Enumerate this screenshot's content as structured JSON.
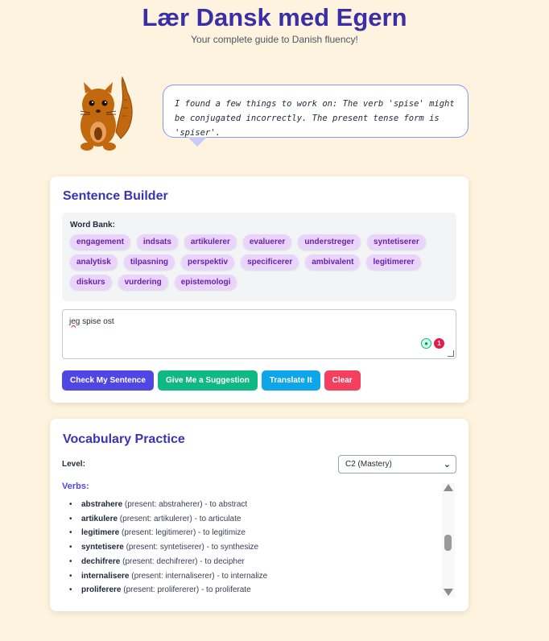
{
  "header": {
    "title": "Lær Dansk med Egern",
    "subtitle": "Your complete guide to Danish fluency!"
  },
  "mascot": {
    "icon": "squirrel-icon",
    "speech": "I found a few things to work on: The verb 'spise' might be conjugated incorrectly. The present tense form is 'spiser'."
  },
  "sentence_builder": {
    "title": "Sentence Builder",
    "word_bank_label": "Word Bank:",
    "words": [
      "engagement",
      "indsats",
      "artikulerer",
      "evaluerer",
      "understreger",
      "syntetiserer",
      "analytisk",
      "tilpasning",
      "perspektiv",
      "specificerer",
      "ambivalent",
      "legitimerer",
      "diskurs",
      "vurdering",
      "epistemologi"
    ],
    "input_misspelled": "jeg",
    "input_rest": " spise ost",
    "error_count": "1",
    "buttons": {
      "check": "Check My Sentence",
      "suggest": "Give Me a Suggestion",
      "translate": "Translate It",
      "clear": "Clear"
    }
  },
  "vocabulary": {
    "title": "Vocabulary Practice",
    "level_label": "Level:",
    "level_selected": "C2 (Mastery)",
    "verbs_heading": "Verbs:",
    "verbs": [
      {
        "word": "abstrahere",
        "detail": " (present: abstraherer) - to abstract"
      },
      {
        "word": "artikulere",
        "detail": " (present: artikulerer) - to articulate"
      },
      {
        "word": "legitimere",
        "detail": " (present: legitimerer) - to legitimize"
      },
      {
        "word": "syntetisere",
        "detail": " (present: syntetiserer) - to synthesize"
      },
      {
        "word": "dechifrere",
        "detail": " (present: dechifrerer) - to decipher"
      },
      {
        "word": "internalisere",
        "detail": " (present: internaliserer) - to internalize"
      },
      {
        "word": "proliferere",
        "detail": " (present: prolifererer) - to proliferate"
      }
    ]
  },
  "colors": {
    "background": "#fdf3df",
    "title": "#3b2fa6",
    "chip_bg": "#e9d5fb",
    "check_button": "#4f46e5",
    "suggest_button": "#10b981",
    "translate_button": "#0ea5e9",
    "clear_button": "#f43f5e"
  }
}
